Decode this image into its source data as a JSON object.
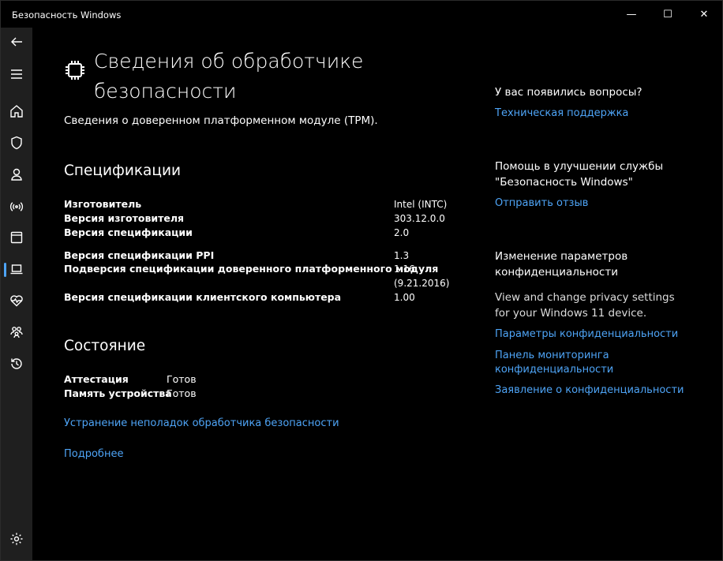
{
  "window": {
    "title": "Безопасность Windows",
    "min_label": "—",
    "max_label": "☐",
    "close_label": "✕"
  },
  "sidebar": {
    "items": [
      {
        "icon": "back-arrow-icon"
      },
      {
        "icon": "hamburger-menu-icon"
      },
      {
        "icon": "home-icon"
      },
      {
        "icon": "shield-icon"
      },
      {
        "icon": "person-icon"
      },
      {
        "icon": "wireless-antenna-icon"
      },
      {
        "icon": "app-browser-icon"
      },
      {
        "icon": "laptop-icon",
        "active": true
      },
      {
        "icon": "heart-pulse-icon"
      },
      {
        "icon": "family-icon"
      },
      {
        "icon": "history-icon"
      },
      {
        "icon": "settings-gear-icon"
      }
    ]
  },
  "header": {
    "title_line1": "Сведения об обработчике",
    "title_line2": "безопасности",
    "subtitle": "Сведения о доверенном платформенном модуле (TPM)."
  },
  "specs": {
    "heading": "Спецификации",
    "rows": [
      {
        "label": "Изготовитель",
        "value": "Intel (INTC)"
      },
      {
        "label": "Версия изготовителя",
        "value": "303.12.0.0"
      },
      {
        "label": "Версия спецификации",
        "value": "2.0"
      },
      {
        "label": "Версия спецификации PPI",
        "value": "1.3"
      },
      {
        "label": "Подверсия спецификации доверенного платформенного модуля",
        "value": "1.16",
        "value2": "(9.21.2016)"
      },
      {
        "label": "Версия спецификации клиентского компьютера",
        "value": "1.00"
      }
    ]
  },
  "status": {
    "heading": "Состояние",
    "rows": [
      {
        "label": "Аттестация",
        "value": "Готов"
      },
      {
        "label": "Память устройства",
        "value": "Готов"
      }
    ],
    "troubleshoot_link": "Устранение неполадок обработчика безопасности",
    "more_link": "Подробнее"
  },
  "right": {
    "questions_heading": "У вас появились вопросы?",
    "support_link": "Техническая поддержка",
    "improve_heading": "Помощь в улучшении службы \"Безопасность Windows\"",
    "feedback_link": "Отправить отзыв",
    "privacy_heading": "Изменение параметров конфиденциальности",
    "privacy_text": "View and change privacy settings for your Windows 11 device.",
    "privacy_settings_link": "Параметры конфиденциальности",
    "privacy_dashboard_link": "Панель мониторинга конфиденциальности",
    "privacy_statement_link": "Заявление о конфиденциальности"
  },
  "colors": {
    "accent": "#4ea4f6",
    "sidebar_bg": "#1f1f1f",
    "background": "#000000"
  }
}
